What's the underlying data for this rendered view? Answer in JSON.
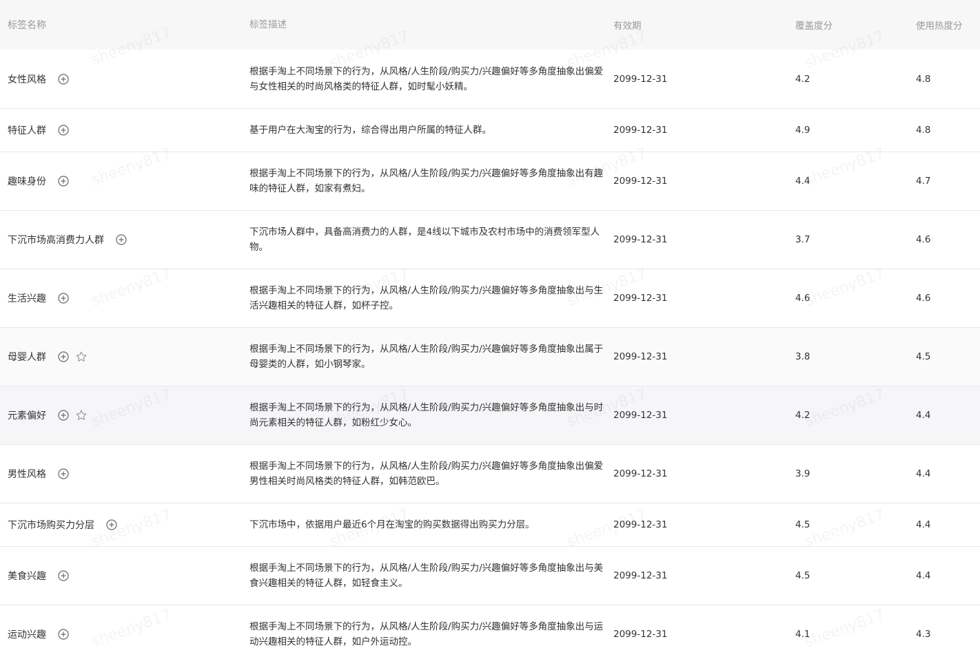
{
  "columns": {
    "name": "标签名称",
    "desc": "标签描述",
    "date": "有效期",
    "coverage": "覆盖度分",
    "heat": "使用热度分"
  },
  "rows": [
    {
      "name": "女性风格",
      "desc": "根据手淘上不同场景下的行为，从风格/人生阶段/购买力/兴趣偏好等多角度抽象出偏爱与女性相关的时尚风格类的特征人群，如时髦小妖精。",
      "date": "2099-12-31",
      "coverage": "4.2",
      "heat": "4.8",
      "star": false
    },
    {
      "name": "特征人群",
      "desc": "基于用户在大淘宝的行为，综合得出用户所属的特征人群。",
      "date": "2099-12-31",
      "coverage": "4.9",
      "heat": "4.8",
      "star": false
    },
    {
      "name": "趣味身份",
      "desc": "根据手淘上不同场景下的行为，从风格/人生阶段/购买力/兴趣偏好等多角度抽象出有趣味的特征人群，如家有煮妇。",
      "date": "2099-12-31",
      "coverage": "4.4",
      "heat": "4.7",
      "star": false
    },
    {
      "name": "下沉市场高消费力人群",
      "desc": "下沉市场人群中，具备高消费力的人群，是4线以下城市及农村市场中的消费领军型人物。",
      "date": "2099-12-31",
      "coverage": "3.7",
      "heat": "4.6",
      "star": false
    },
    {
      "name": "生活兴趣",
      "desc": "根据手淘上不同场景下的行为，从风格/人生阶段/购买力/兴趣偏好等多角度抽象出与生活兴趣相关的特征人群，如杯子控。",
      "date": "2099-12-31",
      "coverage": "4.6",
      "heat": "4.6",
      "star": false
    },
    {
      "name": "母婴人群",
      "desc": "根据手淘上不同场景下的行为，从风格/人生阶段/购买力/兴趣偏好等多角度抽象出属于母婴类的人群，如小钢琴家。",
      "date": "2099-12-31",
      "coverage": "3.8",
      "heat": "4.5",
      "star": true
    },
    {
      "name": "元素偏好",
      "desc": "根据手淘上不同场景下的行为，从风格/人生阶段/购买力/兴趣偏好等多角度抽象出与时尚元素相关的特征人群，如粉红少女心。",
      "date": "2099-12-31",
      "coverage": "4.2",
      "heat": "4.4",
      "star": true
    },
    {
      "name": "男性风格",
      "desc": "根据手淘上不同场景下的行为，从风格/人生阶段/购买力/兴趣偏好等多角度抽象出偏爱男性相关时尚风格类的特征人群，如韩范欧巴。",
      "date": "2099-12-31",
      "coverage": "3.9",
      "heat": "4.4",
      "star": false
    },
    {
      "name": "下沉市场购买力分层",
      "desc": "下沉市场中，依据用户最近6个月在淘宝的购买数据得出购买力分层。",
      "date": "2099-12-31",
      "coverage": "4.5",
      "heat": "4.4",
      "star": false
    },
    {
      "name": "美食兴趣",
      "desc": "根据手淘上不同场景下的行为，从风格/人生阶段/购买力/兴趣偏好等多角度抽象出与美食兴趣相关的特征人群，如轻食主义。",
      "date": "2099-12-31",
      "coverage": "4.5",
      "heat": "4.4",
      "star": false
    },
    {
      "name": "运动兴趣",
      "desc": "根据手淘上不同场景下的行为，从风格/人生阶段/购买力/兴趣偏好等多角度抽象出与运动兴趣相关的特征人群，如户外运动控。",
      "date": "2099-12-31",
      "coverage": "4.1",
      "heat": "4.3",
      "star": false
    }
  ],
  "watermark_text": "sheeny817",
  "icons": {
    "add": "plus-circle-icon",
    "favorite": "star-outline-icon"
  },
  "colors": {
    "header_bg": "#f7f7f8",
    "header_text": "#9a9a9a",
    "body_text": "#333333",
    "border": "#e8e8e8"
  }
}
